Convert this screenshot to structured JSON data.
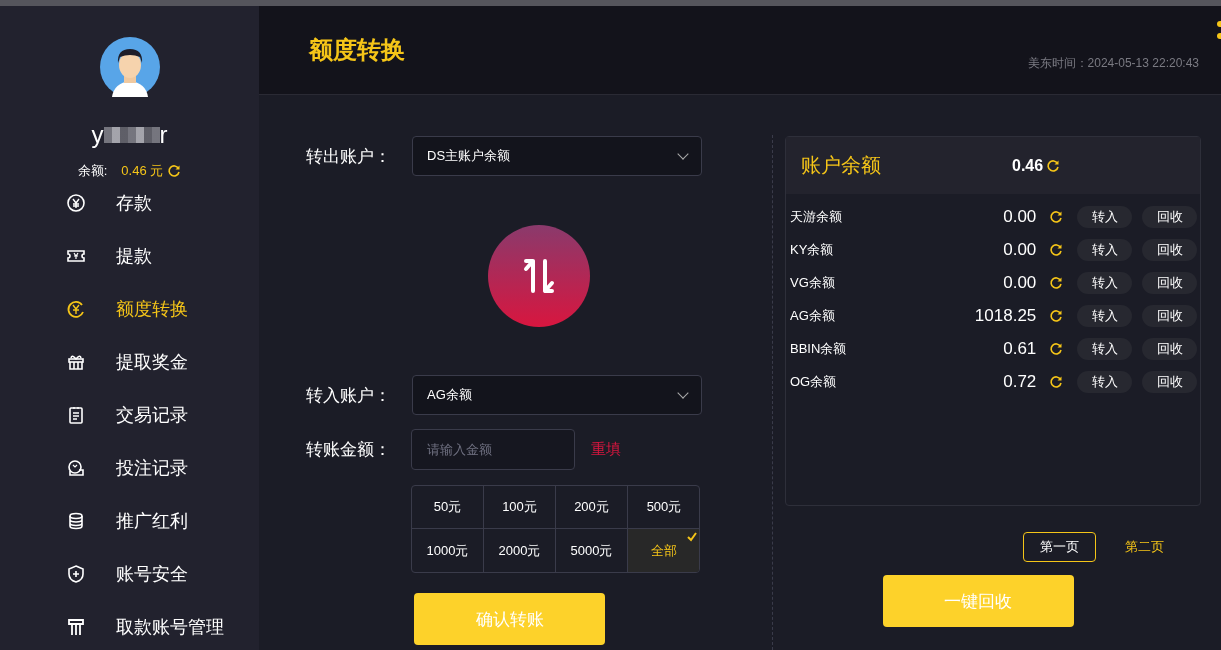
{
  "sidebar": {
    "username_parts": [
      "y",
      "r"
    ],
    "balance_label": "余额:",
    "balance_value": "0.46 元",
    "items": [
      {
        "label": "存款",
        "selected": false
      },
      {
        "label": "提款",
        "selected": false
      },
      {
        "label": "额度转换",
        "selected": true
      },
      {
        "label": "提取奖金",
        "selected": false
      },
      {
        "label": "交易记录",
        "selected": false
      },
      {
        "label": "投注记录",
        "selected": false
      },
      {
        "label": "推广红利",
        "selected": false
      },
      {
        "label": "账号安全",
        "selected": false
      },
      {
        "label": "取款账号管理",
        "selected": false
      }
    ]
  },
  "header": {
    "title": "额度转换",
    "time": "美东时间：2024-05-13 22:20:43"
  },
  "form": {
    "from_label": "转出账户：",
    "from_value": "DS主账户余额",
    "to_label": "转入账户：",
    "to_value": "AG余额",
    "amount_label": "转账金额：",
    "amount_placeholder": "请输入金额",
    "reset": "重填",
    "chips": [
      {
        "label": "50元",
        "selected": false
      },
      {
        "label": "100元",
        "selected": false
      },
      {
        "label": "200元",
        "selected": false
      },
      {
        "label": "500元",
        "selected": false
      },
      {
        "label": "1000元",
        "selected": false
      },
      {
        "label": "2000元",
        "selected": false
      },
      {
        "label": "5000元",
        "selected": false
      },
      {
        "label": "全部",
        "selected": true
      }
    ],
    "confirm": "确认转账"
  },
  "balances": {
    "title": "账户余额",
    "total": "0.46",
    "rows": [
      {
        "name": "天游余额",
        "amount": "0.00",
        "transfer_in": "转入",
        "recover": "回收"
      },
      {
        "name": "KY余额",
        "amount": "0.00",
        "transfer_in": "转入",
        "recover": "回收"
      },
      {
        "name": "VG余额",
        "amount": "0.00",
        "transfer_in": "转入",
        "recover": "回收"
      },
      {
        "name": "AG余额",
        "amount": "1018.25",
        "transfer_in": "转入",
        "recover": "回收"
      },
      {
        "name": "BBIN余额",
        "amount": "0.61",
        "transfer_in": "转入",
        "recover": "回收"
      },
      {
        "name": "OG余额",
        "amount": "0.72",
        "transfer_in": "转入",
        "recover": "回收"
      }
    ],
    "pages": [
      {
        "label": "第一页",
        "selected": true
      },
      {
        "label": "第二页",
        "selected": false
      }
    ],
    "recover_all": "一键回收"
  }
}
